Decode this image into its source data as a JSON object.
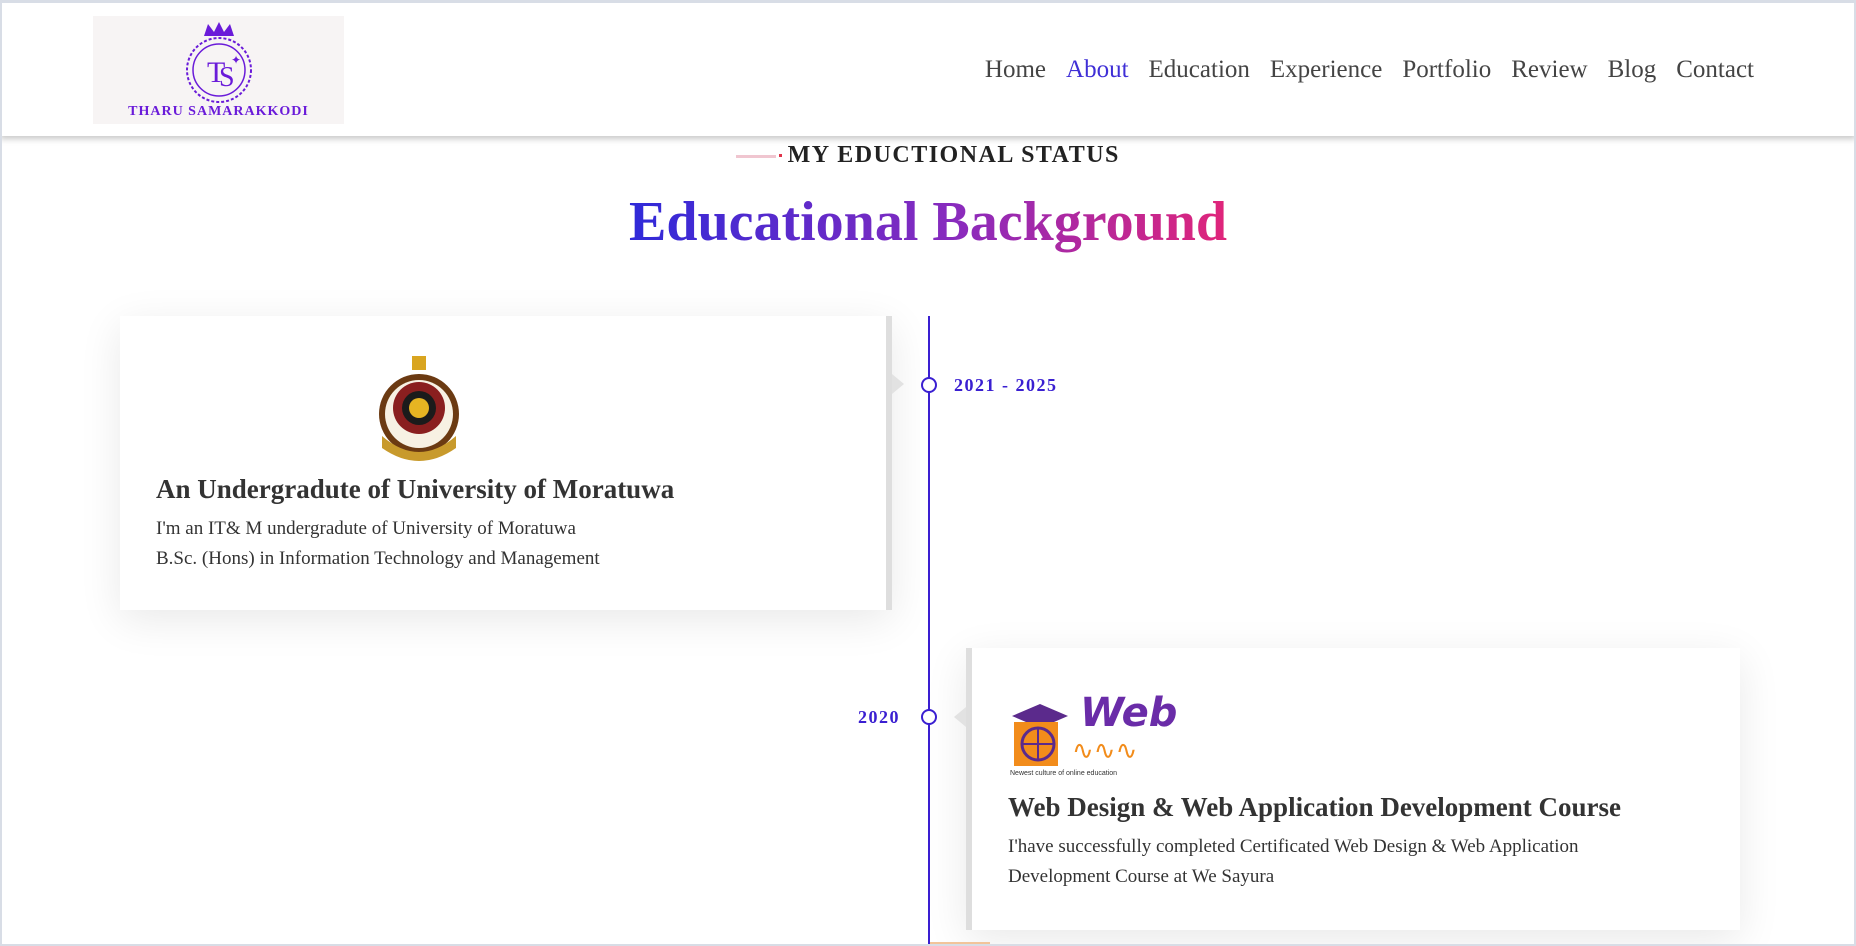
{
  "header": {
    "logo_text": "THARU SAMARAKKODI",
    "nav": [
      "Home",
      "About",
      "Education",
      "Experience",
      "Portfolio",
      "Review",
      "Blog",
      "Contact"
    ],
    "active": "About"
  },
  "section": {
    "subtitle": "MY EDUCTIONAL STATUS",
    "title": "Educational Background"
  },
  "timeline": [
    {
      "date": "2021 - 2025",
      "title": "An Undergradute of University of Moratuwa",
      "lines": [
        "I'm an IT& M undergradute of University of Moratuwa",
        "B.Sc. (Hons) in Information Technology and Management"
      ]
    },
    {
      "date": "2020",
      "title": "Web Design & Web Application Development Course",
      "lines": [
        "I'have successfully completed Certificated Web Design & Web Application",
        "Development Course at We Sayura"
      ],
      "logo_word": "Web",
      "logo_tagline": "Newest culture of online education"
    }
  ],
  "colors": {
    "accent": "#3a1fd1",
    "gradient_start": "#2f2ad9",
    "gradient_end": "#e0257a",
    "logo_purple": "#6a1bd9"
  }
}
